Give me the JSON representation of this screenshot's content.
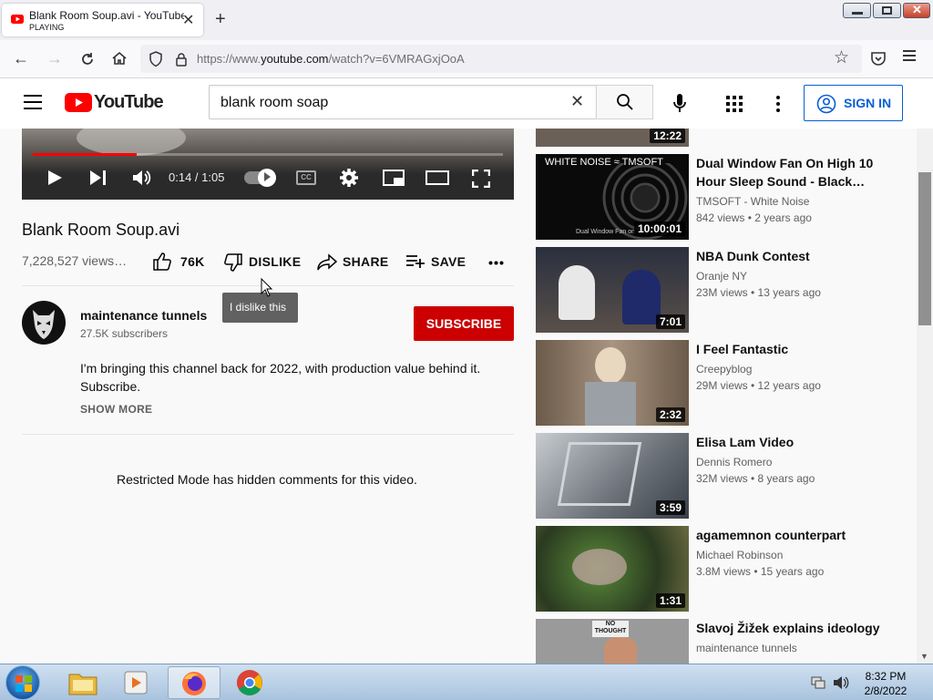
{
  "browser": {
    "tab_title": "Blank Room Soup.avi - YouTube",
    "tab_status": "PLAYING",
    "url_prefix": "https://www.",
    "url_domain": "youtube.com",
    "url_path": "/watch?v=6VMRAGxjOoA"
  },
  "header": {
    "logo_text": "YouTube",
    "search_value": "blank room soap",
    "signin_label": "SIGN IN"
  },
  "player": {
    "time": "0:14 / 1:05",
    "played_fraction": 0.22,
    "cc_label": "CC"
  },
  "video": {
    "title": "Blank Room Soup.avi",
    "views": "7,228,527 views…",
    "like_count": "76K",
    "dislike_label": "DISLIKE",
    "share_label": "SHARE",
    "save_label": "SAVE",
    "tooltip": "I dislike this"
  },
  "channel": {
    "name": "maintenance tunnels",
    "subscribers": "27.5K subscribers",
    "subscribe_label": "SUBSCRIBE",
    "description_line1": "I'm bringing this channel back for 2022, with production value behind it.",
    "description_line2": "Subscribe.",
    "show_more": "SHOW MORE"
  },
  "comments": {
    "restricted": "Restricted Mode has hidden comments for this video."
  },
  "related": {
    "top_partial_duration": "12:22",
    "items": [
      {
        "title": "Dual Window Fan On High 10 Hour Sleep Sound - Black…",
        "channel": "TMSOFT - White Noise",
        "meta": "842 views • 2 years ago",
        "duration": "10:00:01",
        "thumb_label": "WHITE NOISE ≈ TMSOFT",
        "thumb_caption": "Dual Window Fan on"
      },
      {
        "title": "NBA Dunk Contest",
        "channel": "Oranje NY",
        "meta": "23M views • 13 years ago",
        "duration": "7:01"
      },
      {
        "title": "I Feel Fantastic",
        "channel": "Creepyblog",
        "meta": "29M views • 12 years ago",
        "duration": "2:32"
      },
      {
        "title": "Elisa Lam Video",
        "channel": "Dennis Romero",
        "meta": "32M views • 8 years ago",
        "duration": "3:59"
      },
      {
        "title": "agamemnon counterpart",
        "channel": "Michael Robinson",
        "meta": "3.8M views • 15 years ago",
        "duration": "1:31"
      },
      {
        "title": "Slavoj Žižek explains ideology",
        "channel": "maintenance tunnels",
        "meta": "",
        "duration": "",
        "thumb_label": "NO THOUGHT"
      }
    ]
  },
  "taskbar": {
    "time": "8:32 PM",
    "date": "2/8/2022"
  },
  "colors": {
    "youtube_red": "#ff0000",
    "subscribe_red": "#cc0000",
    "signin_blue": "#065fd4"
  }
}
